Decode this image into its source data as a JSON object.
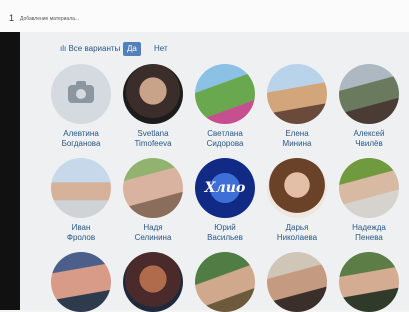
{
  "tab": {
    "number": "1",
    "title": "Добавление материала..."
  },
  "filters": {
    "all": "Все варианты",
    "yes": "Да",
    "no": "Нет"
  },
  "friends": [
    {
      "first": "Алевтина",
      "last": "Богданова"
    },
    {
      "first": "Svetlana",
      "last": "Timofeeva"
    },
    {
      "first": "Светлана",
      "last": "Сидорова"
    },
    {
      "first": "Елена",
      "last": "Минина"
    },
    {
      "first": "Алексей",
      "last": "Чвилёв"
    },
    {
      "first": "Иван",
      "last": "Фролов"
    },
    {
      "first": "Надя",
      "last": "Селинина"
    },
    {
      "first": "Юрий",
      "last": "Васильев"
    },
    {
      "first": "Дарья",
      "last": "Николаева"
    },
    {
      "first": "Надежда",
      "last": "Пенева"
    },
    {
      "first": "",
      "last": ""
    },
    {
      "first": "",
      "last": ""
    },
    {
      "first": "",
      "last": ""
    },
    {
      "first": "",
      "last": ""
    },
    {
      "first": "",
      "last": ""
    }
  ],
  "logo_text": "Хлио",
  "icons": {
    "placeholder": "camera-icon",
    "filter": "bar-chart-icon"
  },
  "colors": {
    "accent": "#5181b8",
    "link": "#2a5885"
  }
}
